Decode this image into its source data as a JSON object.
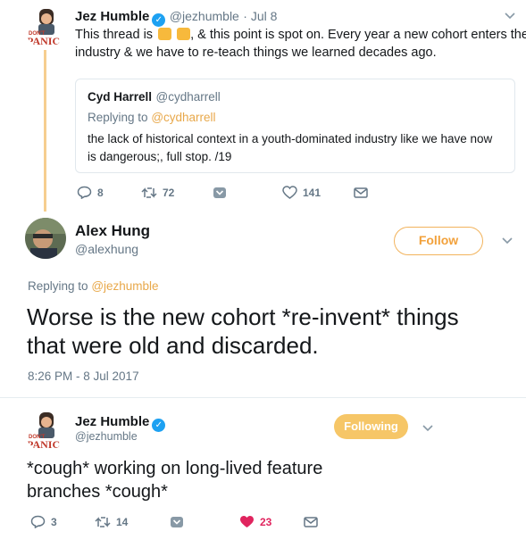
{
  "tweet1": {
    "name": "Jez Humble",
    "handle": "@jezhumble",
    "date": "· Jul 8",
    "text_before": "This thread is",
    "text_after": ", & this point is spot on. Every year a new cohort enters the",
    "text_line2": "industry & we have to re-teach things we learned decades ago.",
    "avatar_text": "DON'T PANIC",
    "quote": {
      "name": "Cyd Harrell",
      "handle": "@cydharrell",
      "replying_prefix": "Replying to",
      "replying_handle": "@cydharrell",
      "line1": "the lack of historical context in a youth-dominated industry like we have now",
      "line2": "is dangerous;, full stop. /19"
    },
    "actions": {
      "replies": "8",
      "retweets": "72",
      "likes": "141"
    }
  },
  "tweet2": {
    "name": "Alex Hung",
    "handle": "@alexhung",
    "follow_label": "Follow",
    "replying_prefix": "Replying to",
    "replying_handle": "@jezhumble",
    "line1": "Worse is the new cohort *re-invent* things",
    "line2": "that were old and discarded.",
    "timestamp": "8:26 PM - 8 Jul 2017"
  },
  "tweet3": {
    "name": "Jez Humble",
    "handle": "@jezhumble",
    "following_label": "Following",
    "avatar_text": "DON'T PANIC",
    "line1": "*cough* working on long-lived feature",
    "line2": "branches *cough*",
    "actions": {
      "replies": "3",
      "retweets": "14",
      "likes": "23"
    }
  },
  "colors": {
    "accent": "#f2a13b",
    "thread_line": "#f6ce8f",
    "verified": "#1da1f2",
    "like_red": "#e0245e",
    "muted": "#657786"
  }
}
